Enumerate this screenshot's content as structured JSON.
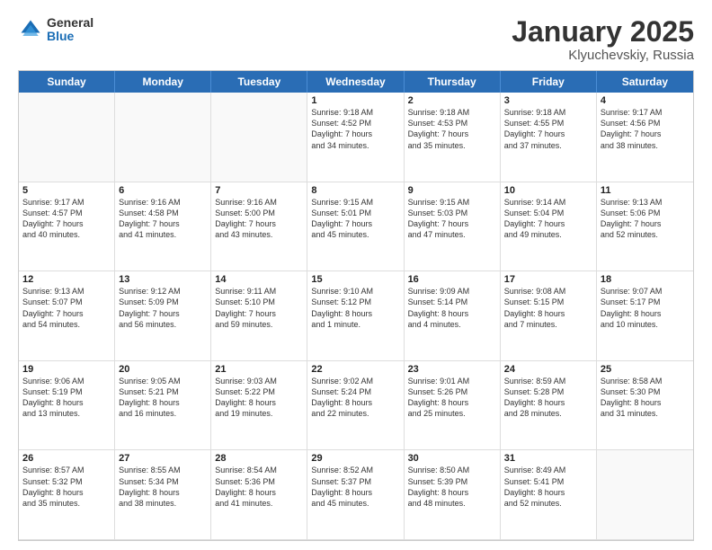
{
  "logo": {
    "general": "General",
    "blue": "Blue"
  },
  "title": "January 2025",
  "location": "Klyuchevskiy, Russia",
  "dayHeaders": [
    "Sunday",
    "Monday",
    "Tuesday",
    "Wednesday",
    "Thursday",
    "Friday",
    "Saturday"
  ],
  "weeks": [
    [
      {
        "day": "",
        "empty": true
      },
      {
        "day": "",
        "empty": true
      },
      {
        "day": "",
        "empty": true
      },
      {
        "day": "1",
        "lines": [
          "Sunrise: 9:18 AM",
          "Sunset: 4:52 PM",
          "Daylight: 7 hours",
          "and 34 minutes."
        ]
      },
      {
        "day": "2",
        "lines": [
          "Sunrise: 9:18 AM",
          "Sunset: 4:53 PM",
          "Daylight: 7 hours",
          "and 35 minutes."
        ]
      },
      {
        "day": "3",
        "lines": [
          "Sunrise: 9:18 AM",
          "Sunset: 4:55 PM",
          "Daylight: 7 hours",
          "and 37 minutes."
        ]
      },
      {
        "day": "4",
        "lines": [
          "Sunrise: 9:17 AM",
          "Sunset: 4:56 PM",
          "Daylight: 7 hours",
          "and 38 minutes."
        ]
      }
    ],
    [
      {
        "day": "5",
        "lines": [
          "Sunrise: 9:17 AM",
          "Sunset: 4:57 PM",
          "Daylight: 7 hours",
          "and 40 minutes."
        ]
      },
      {
        "day": "6",
        "lines": [
          "Sunrise: 9:16 AM",
          "Sunset: 4:58 PM",
          "Daylight: 7 hours",
          "and 41 minutes."
        ]
      },
      {
        "day": "7",
        "lines": [
          "Sunrise: 9:16 AM",
          "Sunset: 5:00 PM",
          "Daylight: 7 hours",
          "and 43 minutes."
        ]
      },
      {
        "day": "8",
        "lines": [
          "Sunrise: 9:15 AM",
          "Sunset: 5:01 PM",
          "Daylight: 7 hours",
          "and 45 minutes."
        ]
      },
      {
        "day": "9",
        "lines": [
          "Sunrise: 9:15 AM",
          "Sunset: 5:03 PM",
          "Daylight: 7 hours",
          "and 47 minutes."
        ]
      },
      {
        "day": "10",
        "lines": [
          "Sunrise: 9:14 AM",
          "Sunset: 5:04 PM",
          "Daylight: 7 hours",
          "and 49 minutes."
        ]
      },
      {
        "day": "11",
        "lines": [
          "Sunrise: 9:13 AM",
          "Sunset: 5:06 PM",
          "Daylight: 7 hours",
          "and 52 minutes."
        ]
      }
    ],
    [
      {
        "day": "12",
        "lines": [
          "Sunrise: 9:13 AM",
          "Sunset: 5:07 PM",
          "Daylight: 7 hours",
          "and 54 minutes."
        ]
      },
      {
        "day": "13",
        "lines": [
          "Sunrise: 9:12 AM",
          "Sunset: 5:09 PM",
          "Daylight: 7 hours",
          "and 56 minutes."
        ]
      },
      {
        "day": "14",
        "lines": [
          "Sunrise: 9:11 AM",
          "Sunset: 5:10 PM",
          "Daylight: 7 hours",
          "and 59 minutes."
        ]
      },
      {
        "day": "15",
        "lines": [
          "Sunrise: 9:10 AM",
          "Sunset: 5:12 PM",
          "Daylight: 8 hours",
          "and 1 minute."
        ]
      },
      {
        "day": "16",
        "lines": [
          "Sunrise: 9:09 AM",
          "Sunset: 5:14 PM",
          "Daylight: 8 hours",
          "and 4 minutes."
        ]
      },
      {
        "day": "17",
        "lines": [
          "Sunrise: 9:08 AM",
          "Sunset: 5:15 PM",
          "Daylight: 8 hours",
          "and 7 minutes."
        ]
      },
      {
        "day": "18",
        "lines": [
          "Sunrise: 9:07 AM",
          "Sunset: 5:17 PM",
          "Daylight: 8 hours",
          "and 10 minutes."
        ]
      }
    ],
    [
      {
        "day": "19",
        "lines": [
          "Sunrise: 9:06 AM",
          "Sunset: 5:19 PM",
          "Daylight: 8 hours",
          "and 13 minutes."
        ]
      },
      {
        "day": "20",
        "lines": [
          "Sunrise: 9:05 AM",
          "Sunset: 5:21 PM",
          "Daylight: 8 hours",
          "and 16 minutes."
        ]
      },
      {
        "day": "21",
        "lines": [
          "Sunrise: 9:03 AM",
          "Sunset: 5:22 PM",
          "Daylight: 8 hours",
          "and 19 minutes."
        ]
      },
      {
        "day": "22",
        "lines": [
          "Sunrise: 9:02 AM",
          "Sunset: 5:24 PM",
          "Daylight: 8 hours",
          "and 22 minutes."
        ]
      },
      {
        "day": "23",
        "lines": [
          "Sunrise: 9:01 AM",
          "Sunset: 5:26 PM",
          "Daylight: 8 hours",
          "and 25 minutes."
        ]
      },
      {
        "day": "24",
        "lines": [
          "Sunrise: 8:59 AM",
          "Sunset: 5:28 PM",
          "Daylight: 8 hours",
          "and 28 minutes."
        ]
      },
      {
        "day": "25",
        "lines": [
          "Sunrise: 8:58 AM",
          "Sunset: 5:30 PM",
          "Daylight: 8 hours",
          "and 31 minutes."
        ]
      }
    ],
    [
      {
        "day": "26",
        "lines": [
          "Sunrise: 8:57 AM",
          "Sunset: 5:32 PM",
          "Daylight: 8 hours",
          "and 35 minutes."
        ]
      },
      {
        "day": "27",
        "lines": [
          "Sunrise: 8:55 AM",
          "Sunset: 5:34 PM",
          "Daylight: 8 hours",
          "and 38 minutes."
        ]
      },
      {
        "day": "28",
        "lines": [
          "Sunrise: 8:54 AM",
          "Sunset: 5:36 PM",
          "Daylight: 8 hours",
          "and 41 minutes."
        ]
      },
      {
        "day": "29",
        "lines": [
          "Sunrise: 8:52 AM",
          "Sunset: 5:37 PM",
          "Daylight: 8 hours",
          "and 45 minutes."
        ]
      },
      {
        "day": "30",
        "lines": [
          "Sunrise: 8:50 AM",
          "Sunset: 5:39 PM",
          "Daylight: 8 hours",
          "and 48 minutes."
        ]
      },
      {
        "day": "31",
        "lines": [
          "Sunrise: 8:49 AM",
          "Sunset: 5:41 PM",
          "Daylight: 8 hours",
          "and 52 minutes."
        ]
      },
      {
        "day": "",
        "empty": true
      }
    ]
  ]
}
